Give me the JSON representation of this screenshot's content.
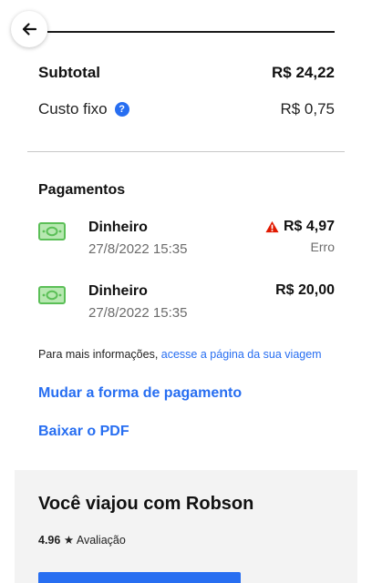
{
  "colors": {
    "accent": "#276ef1",
    "warning": "#e11900",
    "cash": "#6fcf6a"
  },
  "header": {
    "back_icon": "arrow-left-icon"
  },
  "summary": {
    "subtotal_label": "Subtotal",
    "subtotal_value": "R$ 24,22",
    "fee_label": "Custo fixo",
    "fee_help_icon": "?",
    "fee_value": "R$ 0,75"
  },
  "payments": {
    "title": "Pagamentos",
    "items": [
      {
        "method": "Dinheiro",
        "date": "27/8/2022 15:35",
        "amount": "R$ 4,97",
        "status": "Erro",
        "icon": "cash-icon",
        "warning_icon": "warning-icon"
      },
      {
        "method": "Dinheiro",
        "date": "27/8/2022 15:35",
        "amount": "R$ 20,00",
        "status": "",
        "icon": "cash-icon"
      }
    ]
  },
  "info": {
    "text": "Para mais informações, ",
    "link": "acesse a página da sua viagem"
  },
  "actions": {
    "change_payment": "Mudar a forma de pagamento",
    "download_pdf": "Baixar o PDF"
  },
  "driver": {
    "title": "Você viajou com Robson",
    "rating": "4.96",
    "star": "★",
    "rating_label": "Avaliação"
  }
}
